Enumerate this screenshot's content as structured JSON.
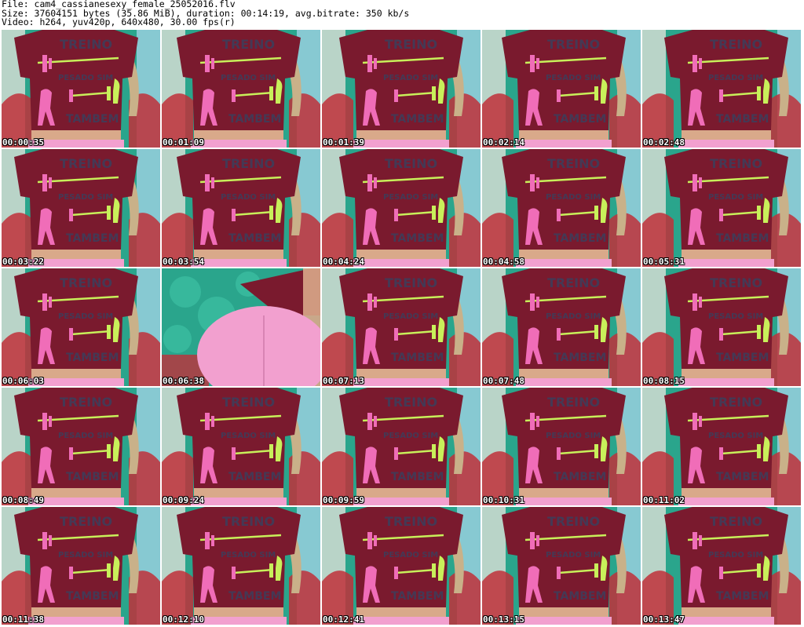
{
  "header": {
    "line1": "File: cam4_cassianesexy_female_25052016.flv",
    "line2": "Size: 37604151 bytes (35.86 MiB), duration: 00:14:19, avg.bitrate: 350 kb/s",
    "line3": "Video: h264, yuv420p, 640x480, 30.00 fps(r)"
  },
  "colors": {
    "shirt": "#7a1a2e",
    "background_green": "#2aa58c",
    "skin": "#d9a98a",
    "hair": "#c9b189",
    "pink": "#f06db8",
    "lime": "#c8f05a",
    "shorts": "#f2a0cf",
    "text_dark": "#3b3f5c"
  },
  "thumbnails": [
    {
      "time": "00:00:35",
      "scene": "shirt"
    },
    {
      "time": "00:01:09",
      "scene": "shirt"
    },
    {
      "time": "00:01:39",
      "scene": "shirt"
    },
    {
      "time": "00:02:14",
      "scene": "shirt"
    },
    {
      "time": "00:02:48",
      "scene": "shirt"
    },
    {
      "time": "00:03:22",
      "scene": "shirt"
    },
    {
      "time": "00:03:54",
      "scene": "shirt"
    },
    {
      "time": "00:04:24",
      "scene": "shirt"
    },
    {
      "time": "00:04:58",
      "scene": "shirt"
    },
    {
      "time": "00:05:31",
      "scene": "shirt"
    },
    {
      "time": "00:06:03",
      "scene": "shirt"
    },
    {
      "time": "00:06:38",
      "scene": "back"
    },
    {
      "time": "00:07:13",
      "scene": "shirt"
    },
    {
      "time": "00:07:48",
      "scene": "shirt"
    },
    {
      "time": "00:08:15",
      "scene": "shirt"
    },
    {
      "time": "00:08:49",
      "scene": "shirt"
    },
    {
      "time": "00:09:24",
      "scene": "shirt"
    },
    {
      "time": "00:09:59",
      "scene": "shirt"
    },
    {
      "time": "00:10:31",
      "scene": "shirt"
    },
    {
      "time": "00:11:02",
      "scene": "shirt"
    },
    {
      "time": "00:11:38",
      "scene": "shirt"
    },
    {
      "time": "00:12:10",
      "scene": "shirt"
    },
    {
      "time": "00:12:41",
      "scene": "shirt"
    },
    {
      "time": "00:13:15",
      "scene": "shirt"
    },
    {
      "time": "00:13:47",
      "scene": "shirt"
    }
  ]
}
